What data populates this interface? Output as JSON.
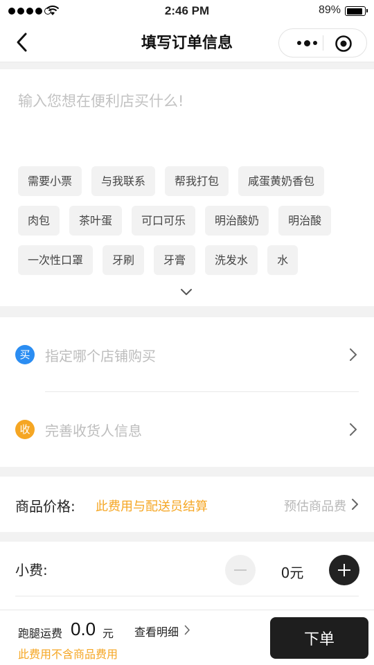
{
  "status_bar": {
    "time": "2:46 PM",
    "battery": "89%",
    "battery_level": 0.89,
    "signal_bars": 4
  },
  "nav": {
    "title": "填写订单信息"
  },
  "order": {
    "placeholder": "输入您想在便利店买什么!",
    "tags": [
      "需要小票",
      "与我联系",
      "帮我打包",
      "咸蛋黄奶香包",
      "肉包",
      "茶叶蛋",
      "可口可乐",
      "明治酸奶",
      "明治酸",
      "一次性口罩",
      "牙刷",
      "牙膏",
      "洗发水",
      "水"
    ]
  },
  "store": {
    "badge": "买",
    "badge_color": "#2b8df2",
    "label": "指定哪个店铺购买"
  },
  "receiver": {
    "badge": "收",
    "badge_color": "#f5a623",
    "label": "完善收货人信息"
  },
  "price": {
    "label": "商品价格:",
    "note": "此费用与配送员结算",
    "link": "预估商品费"
  },
  "tip": {
    "label": "小费:",
    "value": "0元"
  },
  "bottom": {
    "fee_label": "跑腿运费",
    "fee_value": "0.0",
    "fee_unit": "元",
    "fee_note": "此费用不含商品费用",
    "detail": "查看明细",
    "submit": "下单"
  },
  "colors": {
    "accent_orange": "#f5a623",
    "accent_blue": "#2b8df2",
    "dark_button": "#1e1e1e"
  }
}
